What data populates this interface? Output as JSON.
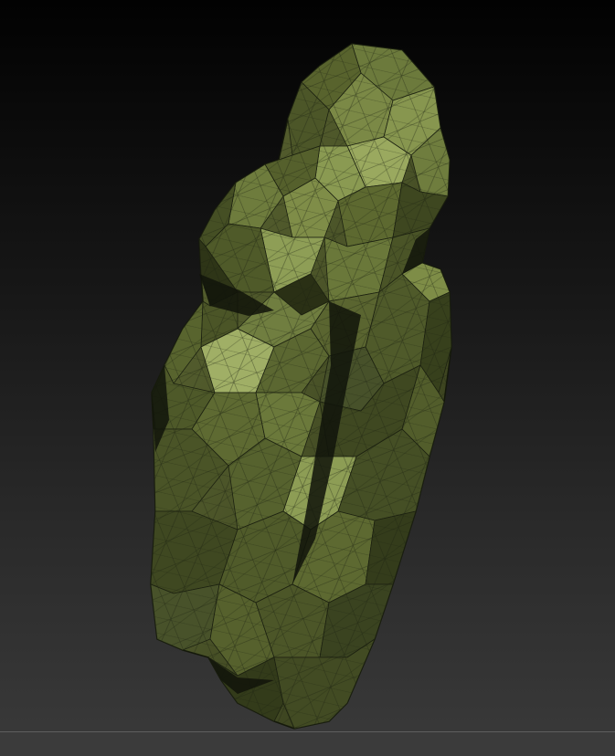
{
  "viewport": {
    "model": "rock-sculpt-mesh",
    "shading": "polyframe",
    "colors": {
      "base": "#4a5328",
      "shadow": "#2b3116",
      "highlight": "#7e8b4a",
      "bright": "#99a860",
      "wire": "#1c2110",
      "background_top": "#020202",
      "background_bottom": "#3a3a3a",
      "bottom_bar": "#3b3b3b"
    }
  }
}
